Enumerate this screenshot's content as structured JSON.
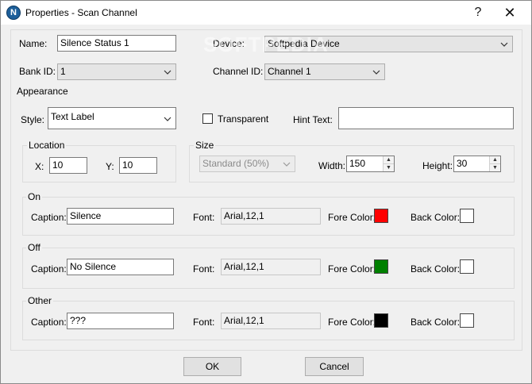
{
  "window": {
    "icon_letter": "N",
    "title": "Properties - Scan Channel",
    "help_glyph": "?",
    "close_glyph": "✕"
  },
  "watermark": "SOFTPEDIA",
  "general": {
    "name_label": "Name:",
    "name_value": "Silence Status 1",
    "device_label": "Device:",
    "device_value": "Softpedia Device",
    "bank_label": "Bank ID:",
    "bank_value": "1",
    "channel_label": "Channel ID:",
    "channel_value": "Channel 1"
  },
  "appearance": {
    "group_title": "Appearance",
    "style_label": "Style:",
    "style_value": "Text Label",
    "transparent_label": "Transparent",
    "transparent_checked": false,
    "hint_label": "Hint Text:",
    "hint_value": ""
  },
  "location": {
    "group_title": "Location",
    "x_label": "X:",
    "x_value": "10",
    "y_label": "Y:",
    "y_value": "10"
  },
  "size": {
    "group_title": "Size",
    "preset_value": "Standard   (50%)",
    "width_label": "Width:",
    "width_value": "150",
    "height_label": "Height:",
    "height_value": "30"
  },
  "states": [
    {
      "group_title": "On",
      "caption_label": "Caption:",
      "caption_value": "Silence",
      "font_label": "Font:",
      "font_value": "Arial,12,1",
      "fore_label": "Fore Color:",
      "fore_color": "#ff0000",
      "back_label": "Back Color:",
      "back_color": "#ffffff"
    },
    {
      "group_title": "Off",
      "caption_label": "Caption:",
      "caption_value": "No Silence",
      "font_label": "Font:",
      "font_value": "Arial,12,1",
      "fore_label": "Fore Color:",
      "fore_color": "#008000",
      "back_label": "Back Color:",
      "back_color": "#ffffff"
    },
    {
      "group_title": "Other",
      "caption_label": "Caption:",
      "caption_value": "???",
      "font_label": "Font:",
      "font_value": "Arial,12,1",
      "fore_label": "Fore Color:",
      "fore_color": "#000000",
      "back_label": "Back Color:",
      "back_color": "#ffffff"
    }
  ],
  "buttons": {
    "ok_label": "OK",
    "cancel_label": "Cancel"
  },
  "icons": {
    "app": "n-logo-icon",
    "dropdown": "chevron-down-icon",
    "spin_up": "spin-up-icon",
    "spin_down": "spin-down-icon"
  }
}
